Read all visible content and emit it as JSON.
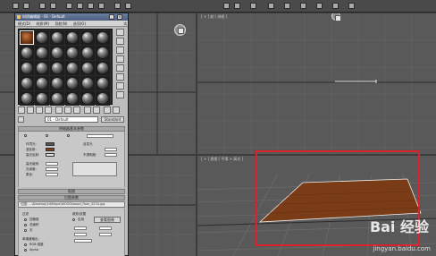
{
  "app": {
    "toolbar_icons": [
      "undo-icon",
      "redo-icon",
      "link-icon",
      "unlink-icon",
      "select-icon",
      "move-icon",
      "rotate-icon",
      "scale-icon",
      "snap-icon",
      "angle-snap-icon",
      "mirror-icon",
      "align-icon",
      "layers-icon",
      "curve-editor-icon",
      "schematic-icon",
      "material-editor-icon",
      "render-setup-icon",
      "render-frame-icon",
      "render-icon"
    ]
  },
  "viewports": {
    "front_label": "[ + ] 前 [ 线框 ]",
    "perspective_label": "[ + ] 透视 [ 平滑 + 高光 ]"
  },
  "material_editor": {
    "title": "材质编辑器 - 01 - Default",
    "menu": [
      "模式(D)",
      "材质(M)",
      "导航(N)",
      "选项(O)",
      "实用程序(U)"
    ],
    "name_label": "01 - Default",
    "type_button": "Standard",
    "rollouts": {
      "basic": "明暗器基本参数",
      "maps": "贴图",
      "bitmap_params": "位图参数"
    },
    "labels": {
      "ambient": "环境光:",
      "diffuse": "漫反射:",
      "specular": "高光反射:",
      "self_illum": "自发光",
      "opacity": "不透明度:",
      "spec_level": "高光级别:",
      "glossiness": "光泽度:",
      "soften": "柔化:",
      "cropping": "裁剪/放置",
      "filtering": "过滤",
      "pyramidal": "四棱锥",
      "summed_area": "总面积",
      "none": "无",
      "mono_output": "单通道输出:",
      "rgb_intensity": "RGB 强度",
      "alpha": "Alpha",
      "apply": "应用",
      "view_image": "查看图像"
    },
    "bitmap_path": "位图: ...\\Desktop\\2d\\Maps\\WOOD\\wood_floor_0234.jpg"
  },
  "watermark": {
    "logo": "Bai 经验",
    "url": "jingyan.baidu.com"
  },
  "colors": {
    "highlight": "#d9222a",
    "wood": "#7a3b17",
    "viewport_bg": "#595959"
  }
}
